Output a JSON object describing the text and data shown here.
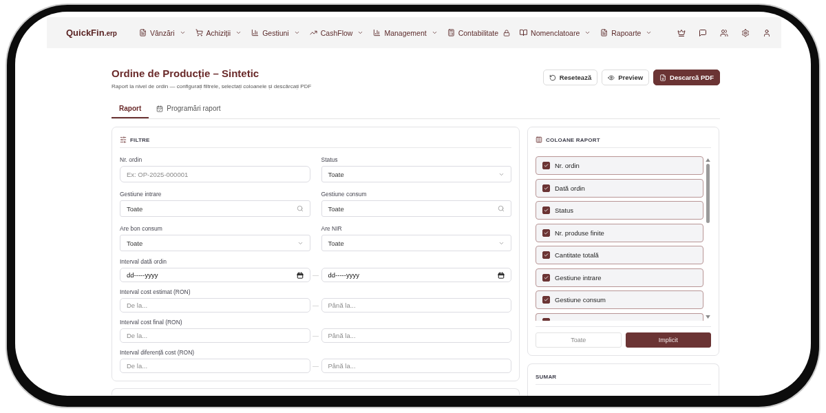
{
  "nav": {
    "logo": {
      "name": "QuickFin",
      "suffix": ".erp"
    },
    "menus": [
      {
        "label": "Vânzări",
        "kind": "dropdown"
      },
      {
        "label": "Achiziții",
        "kind": "dropdown"
      },
      {
        "label": "Gestiuni",
        "kind": "dropdown"
      },
      {
        "label": "CashFlow",
        "kind": "dropdown"
      },
      {
        "label": "Management",
        "kind": "dropdown"
      },
      {
        "label": "Contabilitate",
        "kind": "locked"
      },
      {
        "label": "Nomenclatoare",
        "kind": "dropdown"
      },
      {
        "label": "Rapoarte",
        "kind": "dropdown"
      }
    ]
  },
  "header": {
    "title": "Ordine de Producție – Sintetic",
    "subtitle": "Raport la nivel de ordin — configurați filtrele, selectați coloanele și descărcați PDF",
    "actions": [
      {
        "label": "Resetează",
        "kind": "outline"
      },
      {
        "label": "Preview",
        "kind": "outline"
      },
      {
        "label": "Descarcă PDF",
        "kind": "primary"
      }
    ]
  },
  "tabs": [
    {
      "label": "Raport",
      "selected": true
    },
    {
      "label": "Programări raport",
      "selected": false
    }
  ],
  "filters": {
    "title": "FILTRE",
    "fields": [
      {
        "label": "Nr. ordin",
        "kind": "text",
        "placeholder": "Ex: OP-2025-000001"
      },
      {
        "label": "Status",
        "kind": "select",
        "value": "Toate"
      },
      {
        "label": "Gestiune intrare",
        "kind": "search",
        "value": "Toate"
      },
      {
        "label": "Gestiune consum",
        "kind": "search",
        "value": "Toate"
      },
      {
        "label": "Are bon consum",
        "kind": "select",
        "value": "Toate"
      },
      {
        "label": "Are NIR",
        "kind": "select",
        "value": "Toate"
      }
    ],
    "ranges": [
      {
        "label": "Interval dată ordin",
        "kind": "date",
        "from": {
          "placeholder": "dd-----yyyy"
        },
        "separator": "—",
        "to": {
          "placeholder": "dd-----yyyy"
        }
      },
      {
        "label": "Interval cost estimat (RON)",
        "kind": "number",
        "from": {
          "placeholder": "De la..."
        },
        "separator": "—",
        "to": {
          "placeholder": "Până la..."
        }
      },
      {
        "label": "Interval cost final (RON)",
        "kind": "number",
        "from": {
          "placeholder": "De la..."
        },
        "separator": "—",
        "to": {
          "placeholder": "Până la..."
        }
      },
      {
        "label": "Interval diferență cost (RON)",
        "kind": "number",
        "from": {
          "placeholder": "De la..."
        },
        "separator": "—",
        "to": {
          "placeholder": "Până la..."
        }
      }
    ]
  },
  "columns_panel": {
    "title": "COLOANE RAPORT",
    "items": [
      {
        "label": "Nr. ordin",
        "checked": true
      },
      {
        "label": "Dată ordin",
        "checked": true
      },
      {
        "label": "Status",
        "checked": true
      },
      {
        "label": "Nr. produse finite",
        "checked": true
      },
      {
        "label": "Cantitate totală",
        "checked": true
      },
      {
        "label": "Gestiune intrare",
        "checked": true
      },
      {
        "label": "Gestiune consum",
        "checked": true
      },
      {
        "checked": true
      }
    ],
    "buttons": [
      {
        "label": "Toate",
        "kind": "outline"
      },
      {
        "label": "Implicit",
        "kind": "primary"
      }
    ]
  },
  "summary": {
    "title": "SUMAR"
  }
}
